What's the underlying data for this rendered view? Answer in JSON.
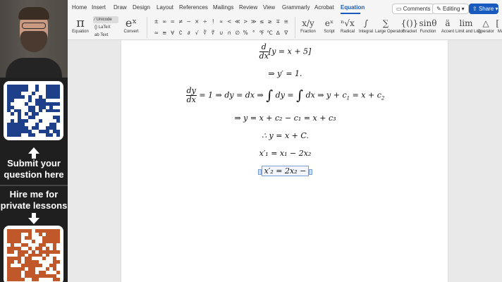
{
  "menu": {
    "tabs": [
      "Home",
      "Insert",
      "Draw",
      "Design",
      "Layout",
      "References",
      "Mailings",
      "Review",
      "View",
      "Grammarly",
      "Acrobat",
      "Equation"
    ],
    "active_tab": "Equation",
    "comments": "Comments",
    "editing": "Editing",
    "share": "Share"
  },
  "toolbar": {
    "equation": "Equation",
    "convert": "Convert",
    "unicode": "Unicode",
    "latex": "LaTeX",
    "text": "Text",
    "symbols_row1": [
      "±",
      "∞",
      "=",
      "≠",
      "~",
      "×",
      "÷",
      "!",
      "∝",
      "<",
      "≪",
      ">",
      "≫",
      "≤",
      "≥",
      "∓",
      "≅"
    ],
    "symbols_row2": [
      "≈",
      "≡",
      "∀",
      "∁",
      "∂",
      "√",
      "∛",
      "∜",
      "∪",
      "∩",
      "∅",
      "%",
      "°",
      "℉",
      "℃",
      "∆",
      "∇"
    ],
    "structures": [
      {
        "glyph": "x/y",
        "label": "Fraction"
      },
      {
        "glyph": "eˣ",
        "label": "Script"
      },
      {
        "glyph": "ⁿ√x",
        "label": "Radical"
      },
      {
        "glyph": "∫",
        "label": "Integral"
      },
      {
        "glyph": "∑",
        "label": "Large Operator"
      },
      {
        "glyph": "{()}",
        "label": "Bracket"
      },
      {
        "glyph": "sinθ",
        "label": "Function"
      },
      {
        "glyph": "ä",
        "label": "Accent"
      },
      {
        "glyph": "lim",
        "label": "Limit and Log"
      },
      {
        "glyph": "△",
        "label": "Operator"
      },
      {
        "glyph": "[⋮]",
        "label": "Matrix"
      }
    ]
  },
  "sidebar": {
    "submit_text": "Submit your question here",
    "hire_text": "Hire me for private lessons"
  },
  "document": {
    "eq1_operand": "[y = x + 5]",
    "eq2": "⇒ y′ = 1.",
    "eq3_a": "= 1 ⇒ dy = dx ⇒",
    "eq3_b": "dy =",
    "eq3_c": "dx ⇒ y + c",
    "eq3_d": "= x + c",
    "eq4": "⇒ y = x + c₂ − c₁ = x + c₃",
    "eq5": "∴ y = x + C.",
    "eq6": "x′₁ = x₁ − 2x₂",
    "eq7": "x′₂ = 2x₂ −"
  },
  "colors": {
    "accent": "#185abd",
    "sidebar": "#1f1f1f",
    "qr_blue": "#1e3f8a",
    "qr_orange": "#c0582a"
  }
}
